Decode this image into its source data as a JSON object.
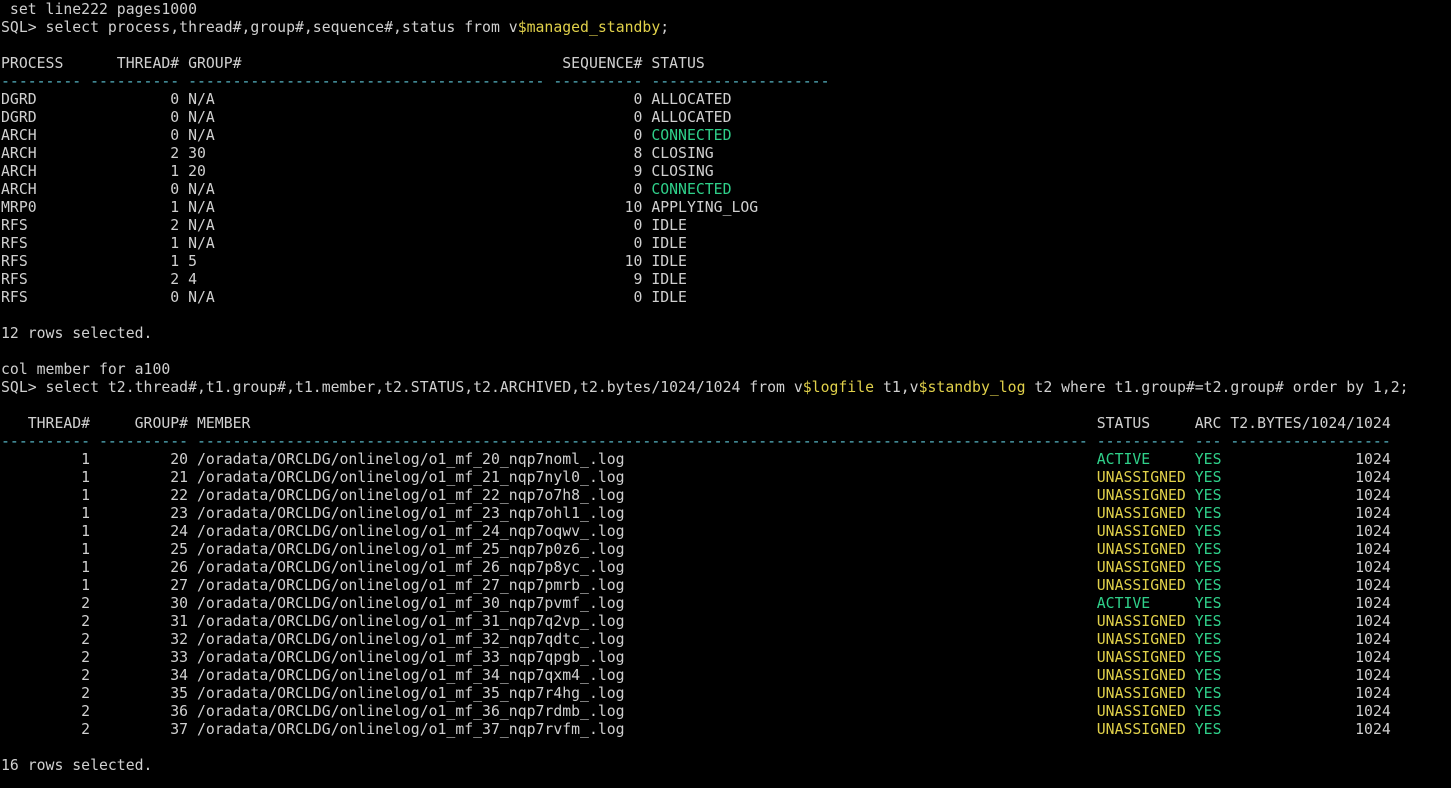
{
  "colors": {
    "background": "#000000",
    "text": "#d0d0d0",
    "highlight_yellow": "#e0d04a",
    "highlight_green": "#2fd08a",
    "separator_cyan": "#58b8c8"
  },
  "lines": [
    [
      {
        "t": " set line222 pages1000"
      }
    ],
    [
      {
        "t": "SQL> select process,thread#,group#,sequence#,status from v"
      },
      {
        "t": "$managed_standby",
        "c": "hl"
      },
      {
        "t": ";"
      }
    ],
    [
      {
        "t": ""
      }
    ],
    [
      {
        "t": "PROCESS      THREAD# GROUP#                                    SEQUENCE# STATUS"
      }
    ],
    [
      {
        "t": "--------- ---------- ---------------------------------------- ---------- --------------------",
        "c": "dash"
      }
    ],
    [
      {
        "t": "DGRD               0 N/A                                               0 ALLOCATED"
      }
    ],
    [
      {
        "t": "DGRD               0 N/A                                               0 ALLOCATED"
      }
    ],
    [
      {
        "t": "ARCH               0 N/A                                               0 "
      },
      {
        "t": "CONNECTED",
        "c": "ok"
      }
    ],
    [
      {
        "t": "ARCH               2 30                                                8 CLOSING"
      }
    ],
    [
      {
        "t": "ARCH               1 20                                                9 CLOSING"
      }
    ],
    [
      {
        "t": "ARCH               0 N/A                                               0 "
      },
      {
        "t": "CONNECTED",
        "c": "ok"
      }
    ],
    [
      {
        "t": "MRP0               1 N/A                                              10 APPLYING_LOG"
      }
    ],
    [
      {
        "t": "RFS                2 N/A                                               0 IDLE"
      }
    ],
    [
      {
        "t": "RFS                1 N/A                                               0 IDLE"
      }
    ],
    [
      {
        "t": "RFS                1 5                                                10 IDLE"
      }
    ],
    [
      {
        "t": "RFS                2 4                                                 9 IDLE"
      }
    ],
    [
      {
        "t": "RFS                0 N/A                                               0 IDLE"
      }
    ],
    [
      {
        "t": ""
      }
    ],
    [
      {
        "t": "12 rows selected."
      }
    ],
    [
      {
        "t": ""
      }
    ],
    [
      {
        "t": "col member for a100"
      }
    ],
    [
      {
        "t": "SQL> select t2.thread#,t1.group#,t1.member,t2.STATUS,t2.ARCHIVED,t2.bytes/1024/1024 from v"
      },
      {
        "t": "$logfile",
        "c": "hl"
      },
      {
        "t": " t1,v"
      },
      {
        "t": "$standby_log",
        "c": "hl"
      },
      {
        "t": " t2 where t1.group#=t2.group# order by 1,2;"
      }
    ],
    [
      {
        "t": ""
      }
    ],
    [
      {
        "t": "   THREAD#     GROUP# MEMBER                                                                                               STATUS     ARC T2.BYTES/1024/1024"
      }
    ],
    [
      {
        "t": "---------- ---------- ---------------------------------------------------------------------------------------------------- ---------- --- ------------------",
        "c": "dash"
      }
    ],
    [
      {
        "t": "         1         20 /oradata/ORCLDG/onlinelog/o1_mf_20_nqp7noml_.log                                                     "
      },
      {
        "t": "ACTIVE    ",
        "c": "ok"
      },
      {
        "t": " "
      },
      {
        "t": "YES",
        "c": "ok"
      },
      {
        "t": "               1024"
      }
    ],
    [
      {
        "t": "         1         21 /oradata/ORCLDG/onlinelog/o1_mf_21_nqp7nyl0_.log                                                     "
      },
      {
        "t": "UNASSIGNED",
        "c": "warn"
      },
      {
        "t": " "
      },
      {
        "t": "YES",
        "c": "ok"
      },
      {
        "t": "               1024"
      }
    ],
    [
      {
        "t": "         1         22 /oradata/ORCLDG/onlinelog/o1_mf_22_nqp7o7h8_.log                                                     "
      },
      {
        "t": "UNASSIGNED",
        "c": "warn"
      },
      {
        "t": " "
      },
      {
        "t": "YES",
        "c": "ok"
      },
      {
        "t": "               1024"
      }
    ],
    [
      {
        "t": "         1         23 /oradata/ORCLDG/onlinelog/o1_mf_23_nqp7ohl1_.log                                                     "
      },
      {
        "t": "UNASSIGNED",
        "c": "warn"
      },
      {
        "t": " "
      },
      {
        "t": "YES",
        "c": "ok"
      },
      {
        "t": "               1024"
      }
    ],
    [
      {
        "t": "         1         24 /oradata/ORCLDG/onlinelog/o1_mf_24_nqp7oqwv_.log                                                     "
      },
      {
        "t": "UNASSIGNED",
        "c": "warn"
      },
      {
        "t": " "
      },
      {
        "t": "YES",
        "c": "ok"
      },
      {
        "t": "               1024"
      }
    ],
    [
      {
        "t": "         1         25 /oradata/ORCLDG/onlinelog/o1_mf_25_nqp7p0z6_.log                                                     "
      },
      {
        "t": "UNASSIGNED",
        "c": "warn"
      },
      {
        "t": " "
      },
      {
        "t": "YES",
        "c": "ok"
      },
      {
        "t": "               1024"
      }
    ],
    [
      {
        "t": "         1         26 /oradata/ORCLDG/onlinelog/o1_mf_26_nqp7p8yc_.log                                                     "
      },
      {
        "t": "UNASSIGNED",
        "c": "warn"
      },
      {
        "t": " "
      },
      {
        "t": "YES",
        "c": "ok"
      },
      {
        "t": "               1024"
      }
    ],
    [
      {
        "t": "         1         27 /oradata/ORCLDG/onlinelog/o1_mf_27_nqp7pmrb_.log                                                     "
      },
      {
        "t": "UNASSIGNED",
        "c": "warn"
      },
      {
        "t": " "
      },
      {
        "t": "YES",
        "c": "ok"
      },
      {
        "t": "               1024"
      }
    ],
    [
      {
        "t": "         2         30 /oradata/ORCLDG/onlinelog/o1_mf_30_nqp7pvmf_.log                                                     "
      },
      {
        "t": "ACTIVE    ",
        "c": "ok"
      },
      {
        "t": " "
      },
      {
        "t": "YES",
        "c": "ok"
      },
      {
        "t": "               1024"
      }
    ],
    [
      {
        "t": "         2         31 /oradata/ORCLDG/onlinelog/o1_mf_31_nqp7q2vp_.log                                                     "
      },
      {
        "t": "UNASSIGNED",
        "c": "warn"
      },
      {
        "t": " "
      },
      {
        "t": "YES",
        "c": "ok"
      },
      {
        "t": "               1024"
      }
    ],
    [
      {
        "t": "         2         32 /oradata/ORCLDG/onlinelog/o1_mf_32_nqp7qdtc_.log                                                     "
      },
      {
        "t": "UNASSIGNED",
        "c": "warn"
      },
      {
        "t": " "
      },
      {
        "t": "YES",
        "c": "ok"
      },
      {
        "t": "               1024"
      }
    ],
    [
      {
        "t": "         2         33 /oradata/ORCLDG/onlinelog/o1_mf_33_nqp7qpgb_.log                                                     "
      },
      {
        "t": "UNASSIGNED",
        "c": "warn"
      },
      {
        "t": " "
      },
      {
        "t": "YES",
        "c": "ok"
      },
      {
        "t": "               1024"
      }
    ],
    [
      {
        "t": "         2         34 /oradata/ORCLDG/onlinelog/o1_mf_34_nqp7qxm4_.log                                                     "
      },
      {
        "t": "UNASSIGNED",
        "c": "warn"
      },
      {
        "t": " "
      },
      {
        "t": "YES",
        "c": "ok"
      },
      {
        "t": "               1024"
      }
    ],
    [
      {
        "t": "         2         35 /oradata/ORCLDG/onlinelog/o1_mf_35_nqp7r4hg_.log                                                     "
      },
      {
        "t": "UNASSIGNED",
        "c": "warn"
      },
      {
        "t": " "
      },
      {
        "t": "YES",
        "c": "ok"
      },
      {
        "t": "               1024"
      }
    ],
    [
      {
        "t": "         2         36 /oradata/ORCLDG/onlinelog/o1_mf_36_nqp7rdmb_.log                                                     "
      },
      {
        "t": "UNASSIGNED",
        "c": "warn"
      },
      {
        "t": " "
      },
      {
        "t": "YES",
        "c": "ok"
      },
      {
        "t": "               1024"
      }
    ],
    [
      {
        "t": "         2         37 /oradata/ORCLDG/onlinelog/o1_mf_37_nqp7rvfm_.log                                                     "
      },
      {
        "t": "UNASSIGNED",
        "c": "warn"
      },
      {
        "t": " "
      },
      {
        "t": "YES",
        "c": "ok"
      },
      {
        "t": "               1024"
      }
    ],
    [
      {
        "t": ""
      }
    ],
    [
      {
        "t": "16 rows selected."
      }
    ]
  ]
}
